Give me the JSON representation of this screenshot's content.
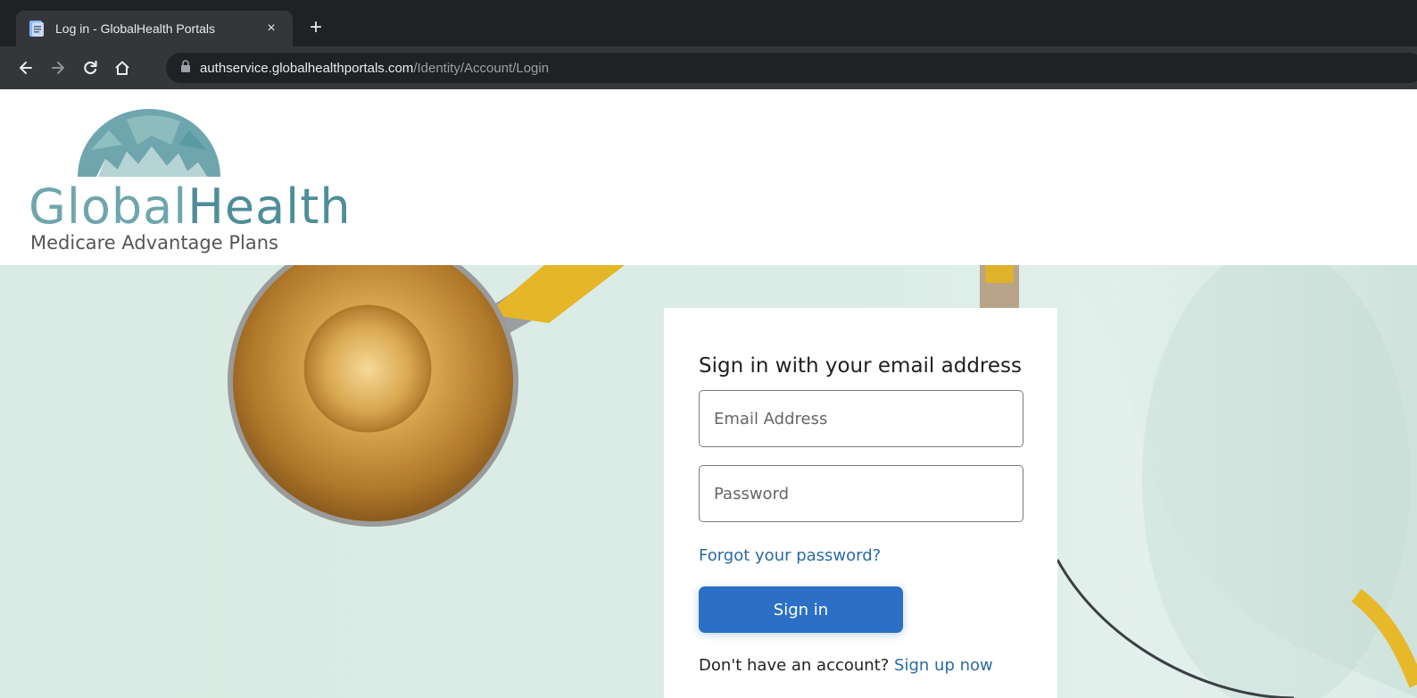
{
  "browser": {
    "tab_title": "Log in - GlobalHealth Portals",
    "close_label": "×",
    "new_tab_label": "+",
    "url_host": "authservice.globalhealthportals.com",
    "url_path": "/Identity/Account/Login"
  },
  "header": {
    "brand_first": "Global",
    "brand_second": "Health",
    "tagline": "Medicare Advantage Plans",
    "colors": {
      "brand_light": "#6fa6ad",
      "brand_dark": "#4f8e98"
    }
  },
  "login": {
    "title": "Sign in with your email address",
    "email_placeholder": "Email Address",
    "email_value": "",
    "password_placeholder": "Password",
    "password_value": "",
    "forgot_label": "Forgot your password?",
    "signin_label": "Sign in",
    "signup_prompt": "Don't have an account? ",
    "signup_label": "Sign up now",
    "colors": {
      "button": "#2b6fc7",
      "link": "#2a6aa3"
    }
  },
  "icons": [
    "page-icon",
    "close-icon",
    "plus-icon",
    "arrow-left-icon",
    "arrow-right-icon",
    "reload-icon",
    "home-icon",
    "lock-icon"
  ]
}
